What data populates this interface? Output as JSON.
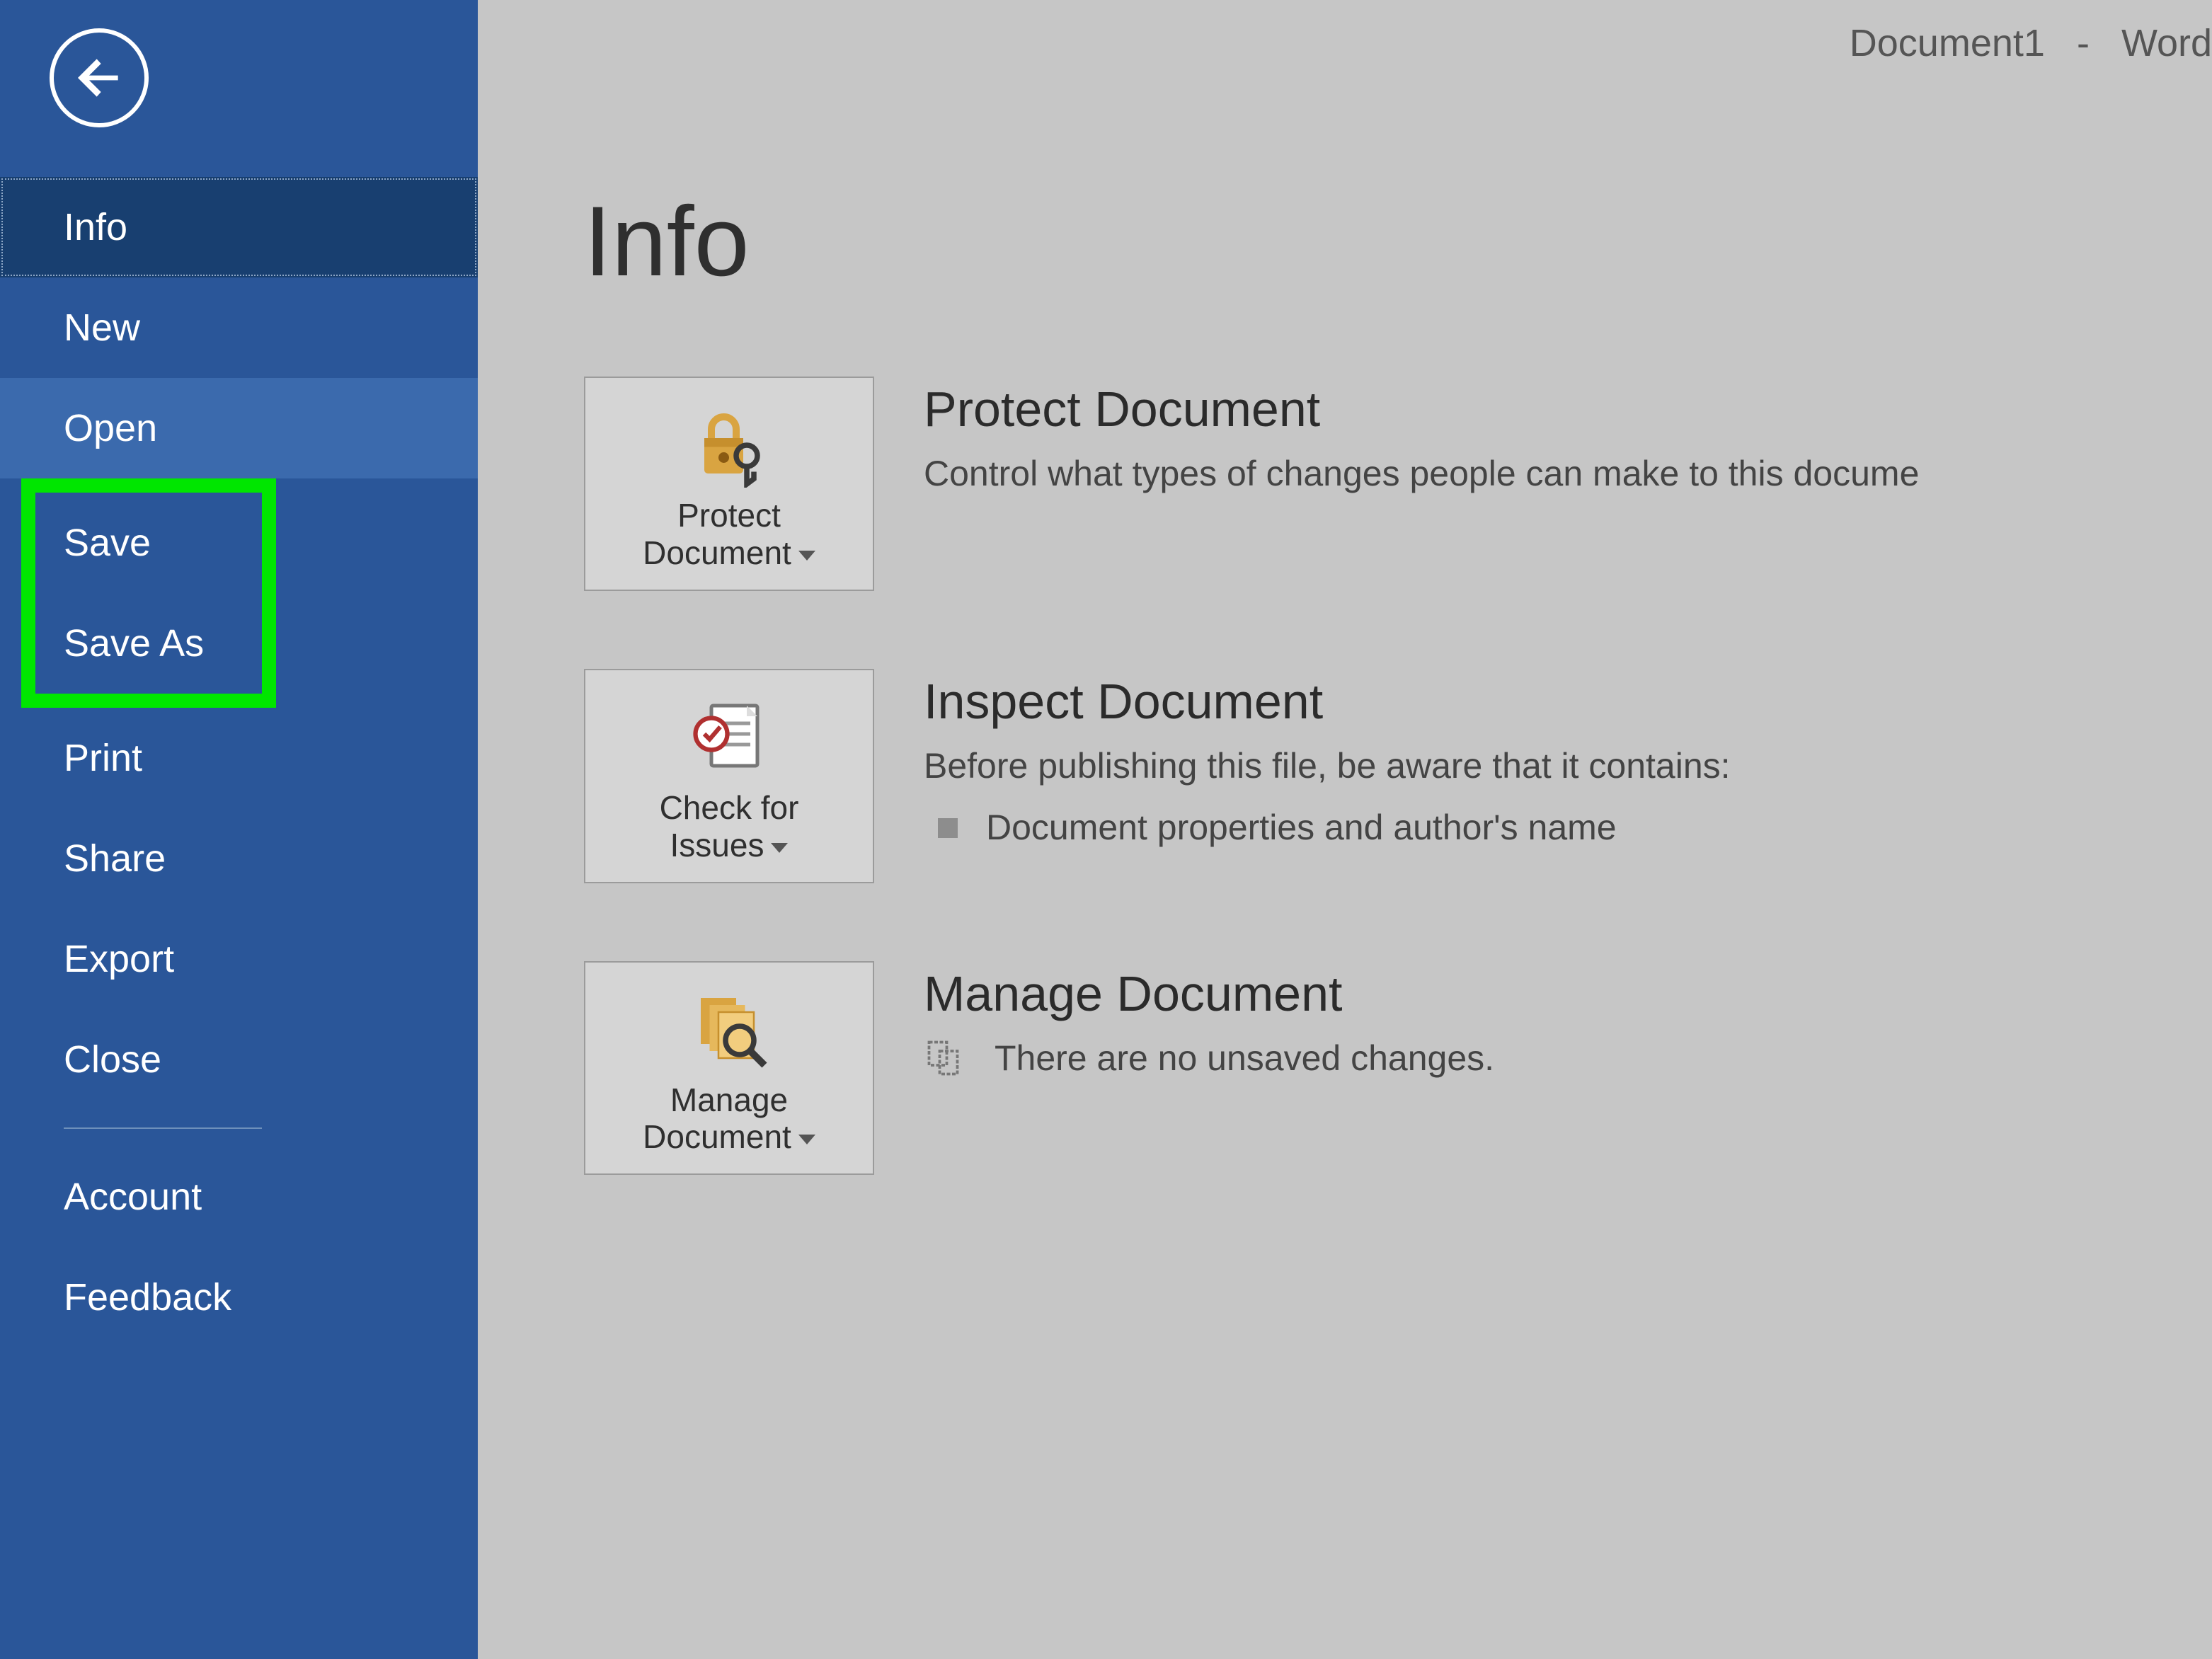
{
  "titlebar": {
    "doc_name": "Document1",
    "separator": "-",
    "app_name": "Word"
  },
  "sidebar": {
    "items": [
      {
        "label": "Info",
        "state": "active"
      },
      {
        "label": "New",
        "state": ""
      },
      {
        "label": "Open",
        "state": "hover"
      },
      {
        "label": "Save",
        "state": "hl"
      },
      {
        "label": "Save As",
        "state": "hl"
      },
      {
        "label": "Print",
        "state": ""
      },
      {
        "label": "Share",
        "state": ""
      },
      {
        "label": "Export",
        "state": ""
      },
      {
        "label": "Close",
        "state": ""
      },
      {
        "label": "Account",
        "state": ""
      },
      {
        "label": "Feedback",
        "state": ""
      }
    ],
    "highlight_color": "#00e600"
  },
  "main": {
    "page_title": "Info",
    "sections": [
      {
        "id": "protect",
        "tile": {
          "icon": "lock-key-icon",
          "line1": "Protect",
          "line2": "Document"
        },
        "title": "Protect Document",
        "desc": "Control what types of changes people can make to this docume"
      },
      {
        "id": "inspect",
        "tile": {
          "icon": "check-doc-icon",
          "line1": "Check for",
          "line2": "Issues"
        },
        "title": "Inspect Document",
        "desc": "Before publishing this file, be aware that it contains:",
        "bullets": [
          "Document properties and author's name"
        ]
      },
      {
        "id": "manage",
        "tile": {
          "icon": "stack-magnify-icon",
          "line1": "Manage",
          "line2": "Document"
        },
        "title": "Manage Document",
        "status_icon": "restore-icon",
        "status_text": "There are no unsaved changes."
      }
    ]
  },
  "colors": {
    "sidebar_bg": "#2a5699",
    "sidebar_active": "#183f70",
    "main_bg": "#c6c6c6"
  }
}
